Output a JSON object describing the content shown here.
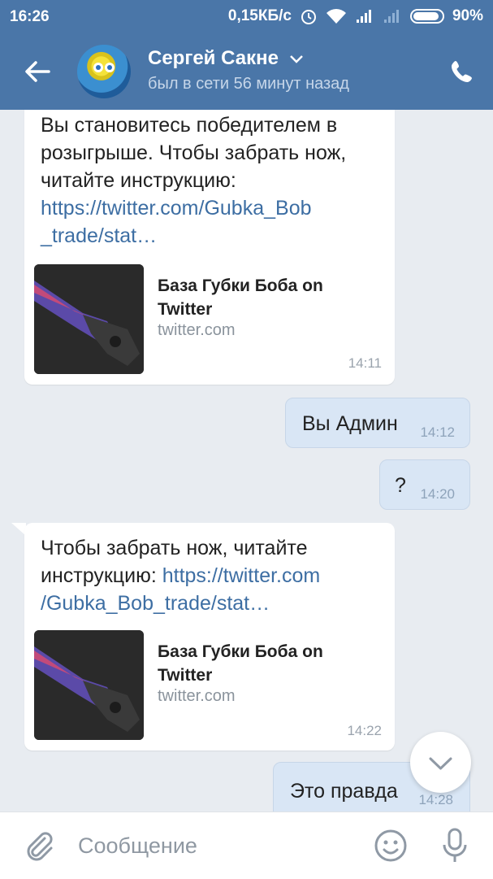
{
  "status_bar": {
    "time": "16:26",
    "speed": "0,15КБ/с",
    "battery": "90%"
  },
  "header": {
    "name": "Сергей Сакне",
    "status": "был в сети 56 минут назад"
  },
  "messages": [
    {
      "text": "Вы становитесь победителем в розыгрыше. Чтобы забрать нож, читайте инструкцию:",
      "link_line1": "https://twitter.com/Gubka_Bob",
      "link_line2": "_trade/stat…",
      "preview_title": "База Губки Боба on Twitter",
      "preview_domain": "twitter.com",
      "time": "14:11"
    },
    {
      "text": "Вы Админ",
      "time": "14:12"
    },
    {
      "text": "?",
      "time": "14:20"
    },
    {
      "text_line1": "Чтобы забрать нож, читайте",
      "text_line2_prefix": "инструкцию:",
      "link_part1": "https://twitter.com",
      "link_line2": "/Gubka_Bob_trade/stat…",
      "preview_title": "База Губки Боба on Twitter",
      "preview_domain": "twitter.com",
      "time": "14:22"
    },
    {
      "text": "Это правда",
      "time": "14:28"
    }
  ],
  "composer": {
    "placeholder": "Сообщение"
  },
  "colors": {
    "header": "#4a76a8",
    "chat_bg": "#e8ecf1",
    "outgoing": "#d9e6f5",
    "link": "#3d6ea3"
  }
}
